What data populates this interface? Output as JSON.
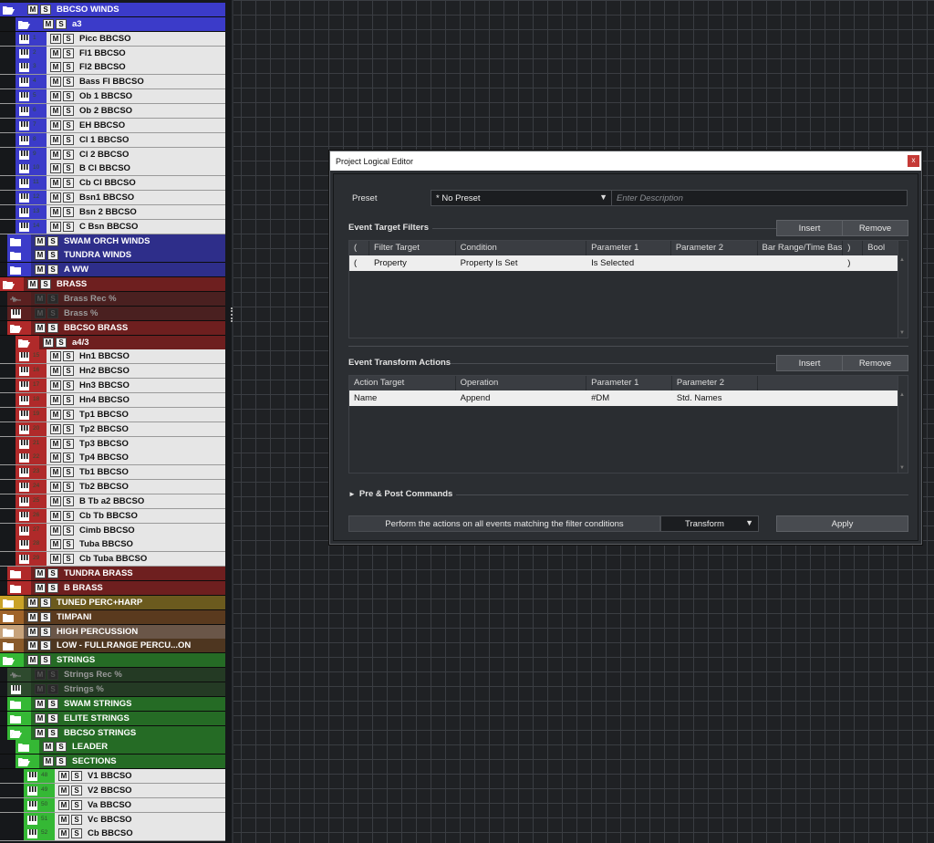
{
  "tracks": [
    {
      "n": "BBCSO WINDS",
      "i": "folder-open",
      "c": "#3b3bc9",
      "x": 0,
      "bg": "#3b3bc9",
      "light": true
    },
    {
      "n": "a3",
      "i": "folder-open",
      "c": "#3b3bc9",
      "x": 17,
      "bg": "#3b3bc9",
      "light": true
    },
    {
      "n": "Picc BBCSO",
      "i": "instrument",
      "c": "#3b3bc9",
      "x": 17,
      "num": "1",
      "bg": "#e6e6e6"
    },
    {
      "n": "Fl1 BBCSO",
      "i": "instrument",
      "c": "#3b3bc9",
      "x": 17,
      "num": "2",
      "bg": "#e6e6e6"
    },
    {
      "n": "Fl2 BBCSO",
      "i": "instrument",
      "c": "#3b3bc9",
      "x": 17,
      "num": "3",
      "bg": "#e6e6e6"
    },
    {
      "n": "Bass Fl BBCSO",
      "i": "instrument",
      "c": "#3b3bc9",
      "x": 17,
      "num": "4",
      "bg": "#e6e6e6"
    },
    {
      "n": "Ob 1 BBCSO",
      "i": "instrument",
      "c": "#3b3bc9",
      "x": 17,
      "num": "5",
      "bg": "#e6e6e6"
    },
    {
      "n": "Ob 2 BBCSO",
      "i": "instrument",
      "c": "#3b3bc9",
      "x": 17,
      "num": "6",
      "bg": "#e6e6e6"
    },
    {
      "n": "EH BBCSO",
      "i": "instrument",
      "c": "#3b3bc9",
      "x": 17,
      "num": "7",
      "bg": "#e6e6e6"
    },
    {
      "n": "Cl 1 BBCSO",
      "i": "instrument",
      "c": "#3b3bc9",
      "x": 17,
      "num": "8",
      "bg": "#e6e6e6"
    },
    {
      "n": "Cl 2 BBCSO",
      "i": "instrument",
      "c": "#3b3bc9",
      "x": 17,
      "num": "9",
      "bg": "#e6e6e6"
    },
    {
      "n": "B Cl BBCSO",
      "i": "instrument",
      "c": "#3b3bc9",
      "x": 17,
      "num": "10",
      "bg": "#e6e6e6"
    },
    {
      "n": "Cb Cl BBCSO",
      "i": "instrument",
      "c": "#3b3bc9",
      "x": 17,
      "num": "11",
      "bg": "#e6e6e6"
    },
    {
      "n": "Bsn1 BBCSO",
      "i": "instrument",
      "c": "#3b3bc9",
      "x": 17,
      "num": "12",
      "bg": "#e6e6e6"
    },
    {
      "n": "Bsn 2 BBCSO",
      "i": "instrument",
      "c": "#3b3bc9",
      "x": 17,
      "num": "13",
      "bg": "#e6e6e6"
    },
    {
      "n": "C Bsn BBCSO",
      "i": "instrument",
      "c": "#3b3bc9",
      "x": 17,
      "num": "14",
      "bg": "#e6e6e6"
    },
    {
      "n": "SWAM ORCH WINDS",
      "i": "folder",
      "c": "#3b3bc9",
      "x": 8,
      "bg": "#2e2e8a",
      "light": true
    },
    {
      "n": "TUNDRA WINDS",
      "i": "folder",
      "c": "#3b3bc9",
      "x": 8,
      "bg": "#2e2e8a",
      "light": true
    },
    {
      "n": "A WW",
      "i": "folder",
      "c": "#3b3bc9",
      "x": 8,
      "bg": "#2e2e8a",
      "light": true
    },
    {
      "n": "BRASS",
      "i": "folder-open",
      "c": "#b02a2a",
      "x": 0,
      "bg": "#6e1f1f",
      "light": true
    },
    {
      "n": "Brass Rec %",
      "i": "audio",
      "c": "#5a2020",
      "x": 8,
      "bg": "#4a2020",
      "muted": true
    },
    {
      "n": "Brass %",
      "i": "instrument",
      "c": "#5a2020",
      "x": 8,
      "bg": "#4a2020",
      "muted": true
    },
    {
      "n": "BBCSO BRASS",
      "i": "folder-open",
      "c": "#b02a2a",
      "x": 8,
      "bg": "#6e1f1f",
      "light": true
    },
    {
      "n": "a4/3",
      "i": "folder-open",
      "c": "#b02a2a",
      "x": 17,
      "bg": "#6e1f1f",
      "light": true
    },
    {
      "n": "Hn1 BBCSO",
      "i": "instrument",
      "c": "#b02a2a",
      "x": 17,
      "num": "15",
      "bg": "#e6e6e6"
    },
    {
      "n": "Hn2 BBCSO",
      "i": "instrument",
      "c": "#b02a2a",
      "x": 17,
      "num": "16",
      "bg": "#e6e6e6"
    },
    {
      "n": "Hn3 BBCSO",
      "i": "instrument",
      "c": "#b02a2a",
      "x": 17,
      "num": "17",
      "bg": "#e6e6e6"
    },
    {
      "n": "Hn4 BBCSO",
      "i": "instrument",
      "c": "#b02a2a",
      "x": 17,
      "num": "18",
      "bg": "#e6e6e6"
    },
    {
      "n": "Tp1 BBCSO",
      "i": "instrument",
      "c": "#b02a2a",
      "x": 17,
      "num": "19",
      "bg": "#e6e6e6"
    },
    {
      "n": "Tp2 BBCSO",
      "i": "instrument",
      "c": "#b02a2a",
      "x": 17,
      "num": "20",
      "bg": "#e6e6e6"
    },
    {
      "n": "Tp3 BBCSO",
      "i": "instrument",
      "c": "#b02a2a",
      "x": 17,
      "num": "21",
      "bg": "#e6e6e6"
    },
    {
      "n": "Tp4 BBCSO",
      "i": "instrument",
      "c": "#b02a2a",
      "x": 17,
      "num": "22",
      "bg": "#e6e6e6"
    },
    {
      "n": "Tb1 BBCSO",
      "i": "instrument",
      "c": "#b02a2a",
      "x": 17,
      "num": "23",
      "bg": "#e6e6e6"
    },
    {
      "n": "Tb2 BBCSO",
      "i": "instrument",
      "c": "#b02a2a",
      "x": 17,
      "num": "24",
      "bg": "#e6e6e6"
    },
    {
      "n": "B Tb a2 BBCSO",
      "i": "instrument",
      "c": "#b02a2a",
      "x": 17,
      "num": "25",
      "bg": "#e6e6e6"
    },
    {
      "n": "Cb Tb BBCSO",
      "i": "instrument",
      "c": "#b02a2a",
      "x": 17,
      "num": "26",
      "bg": "#e6e6e6"
    },
    {
      "n": "Cimb BBCSO",
      "i": "instrument",
      "c": "#b02a2a",
      "x": 17,
      "num": "27",
      "bg": "#e6e6e6"
    },
    {
      "n": "Tuba BBCSO",
      "i": "instrument",
      "c": "#b02a2a",
      "x": 17,
      "num": "28",
      "bg": "#e6e6e6"
    },
    {
      "n": "Cb Tuba BBCSO",
      "i": "instrument",
      "c": "#b02a2a",
      "x": 17,
      "num": "29",
      "bg": "#e6e6e6"
    },
    {
      "n": "TUNDRA BRASS",
      "i": "folder",
      "c": "#b02a2a",
      "x": 8,
      "bg": "#6e1f1f",
      "light": true
    },
    {
      "n": "B BRASS",
      "i": "folder",
      "c": "#b02a2a",
      "x": 8,
      "bg": "#6e1f1f",
      "light": true
    },
    {
      "n": "TUNED PERC+HARP",
      "i": "folder",
      "c": "#c9a227",
      "x": 0,
      "bg": "#6b5a1e",
      "light": true
    },
    {
      "n": "TIMPANI",
      "i": "folder",
      "c": "#a0642a",
      "x": 0,
      "bg": "#5a3a1e",
      "light": true
    },
    {
      "n": "HIGH PERCUSSION",
      "i": "folder",
      "c": "#c7a27a",
      "x": 0,
      "bg": "#6a5648",
      "light": true
    },
    {
      "n": "LOW - FULLRANGE PERCU...ON",
      "i": "folder",
      "c": "#8a5a2a",
      "x": 0,
      "bg": "#4e3620",
      "light": true
    },
    {
      "n": "STRINGS",
      "i": "folder-open",
      "c": "#35b835",
      "x": 0,
      "bg": "#256b25",
      "light": true
    },
    {
      "n": "Strings Rec %",
      "i": "audio",
      "c": "#2e4a2e",
      "x": 8,
      "bg": "#243a24",
      "muted": true
    },
    {
      "n": "Strings %",
      "i": "instrument",
      "c": "#2e4a2e",
      "x": 8,
      "bg": "#243a24",
      "muted": true
    },
    {
      "n": "SWAM STRINGS",
      "i": "folder",
      "c": "#35b835",
      "x": 8,
      "bg": "#256b25",
      "light": true
    },
    {
      "n": "ELITE STRINGS",
      "i": "folder",
      "c": "#35b835",
      "x": 8,
      "bg": "#256b25",
      "light": true
    },
    {
      "n": "BBCSO STRINGS",
      "i": "folder-open",
      "c": "#35b835",
      "x": 8,
      "bg": "#256b25",
      "light": true
    },
    {
      "n": "LEADER",
      "i": "folder",
      "c": "#35b835",
      "x": 17,
      "bg": "#256b25",
      "light": true
    },
    {
      "n": "SECTIONS",
      "i": "folder-open",
      "c": "#35b835",
      "x": 17,
      "bg": "#256b25",
      "light": true
    },
    {
      "n": "V1 BBCSO",
      "i": "instrument",
      "c": "#35b835",
      "x": 26,
      "num": "48",
      "bg": "#e6e6e6"
    },
    {
      "n": "V2 BBCSO",
      "i": "instrument",
      "c": "#35b835",
      "x": 26,
      "num": "49",
      "bg": "#e6e6e6"
    },
    {
      "n": "Va BBCSO",
      "i": "instrument",
      "c": "#35b835",
      "x": 26,
      "num": "50",
      "bg": "#e6e6e6"
    },
    {
      "n": "Vc BBCSO",
      "i": "instrument",
      "c": "#35b835",
      "x": 26,
      "num": "51",
      "bg": "#e6e6e6"
    },
    {
      "n": "Cb BBCSO",
      "i": "instrument",
      "c": "#35b835",
      "x": 26,
      "num": "52",
      "bg": "#e6e6e6"
    }
  ],
  "mute_label": "M",
  "solo_label": "S",
  "dialog": {
    "title": "Project Logical Editor",
    "close": "x",
    "preset_label": "Preset",
    "preset_value": "* No Preset",
    "preset_arrow": "▼",
    "description_placeholder": "Enter Description",
    "filters_title": "Event Target Filters",
    "insert": "Insert",
    "remove": "Remove",
    "filter_headers": [
      "(",
      "Filter Target",
      "Condition",
      "Parameter 1",
      "Parameter 2",
      "Bar Range/Time Base",
      ")",
      "Bool"
    ],
    "filter_row": [
      "(",
      "Property",
      "Property Is Set",
      "Is Selected",
      "",
      "",
      ")",
      ""
    ],
    "splitter": "····",
    "actions_title": "Event Transform Actions",
    "action_headers": [
      "Action Target",
      "Operation",
      "Parameter 1",
      "Parameter 2",
      ""
    ],
    "action_row": [
      "Name",
      "Append",
      "#DM",
      "Std. Names",
      ""
    ],
    "prepost": "Pre & Post Commands",
    "prepost_arrow": "►",
    "footer_text": "Perform the actions on all events matching the filter conditions",
    "function_value": "Transform",
    "function_arrow": "▼",
    "apply": "Apply",
    "scroll_up": "▲",
    "scroll_down": "▼"
  },
  "colors": {
    "winds": "#3b3bc9",
    "brass": "#b02a2a",
    "strings": "#35b835",
    "accent": "#c53a36"
  }
}
